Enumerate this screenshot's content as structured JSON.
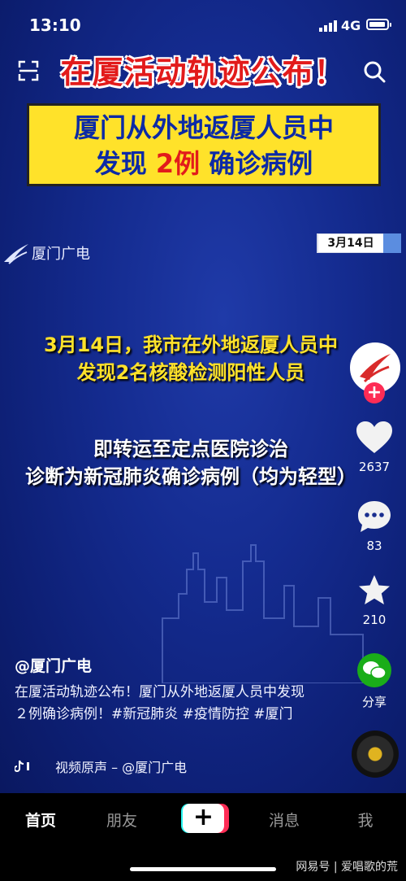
{
  "status_bar": {
    "time": "13:10",
    "network": "4G"
  },
  "video": {
    "headline": "在厦活动轨迹公布！",
    "box_line1": "厦门从外地返厦人员中",
    "box_line2_pre": "发现 ",
    "box_line2_num": "2例",
    "box_line2_post": " 确诊病例",
    "brand": "厦门广电",
    "date_tag": "3月14日",
    "caption1_line1": "3月14日，我市在外地返厦人员中",
    "caption1_line2": "发现2名核酸检测阳性人员",
    "caption2_line1": "即转运至定点医院诊治",
    "caption2_line2": "诊断为新冠肺炎确诊病例（均为轻型）"
  },
  "sidebar": {
    "likes": "2637",
    "comments": "83",
    "favorites": "210",
    "share": "分享"
  },
  "post": {
    "author": "@厦门广电",
    "desc": "在厦活动轨迹公布！厦门从外地返厦人员中发现２例确诊病例！#新冠肺炎 #疫情防控 #厦门",
    "music": "视频原声 – @厦门广电"
  },
  "nav": {
    "home": "首页",
    "friends": "朋友",
    "create": "+",
    "messages": "消息",
    "me": "我"
  },
  "watermark": "网易号 | 爱唱歌的荒"
}
